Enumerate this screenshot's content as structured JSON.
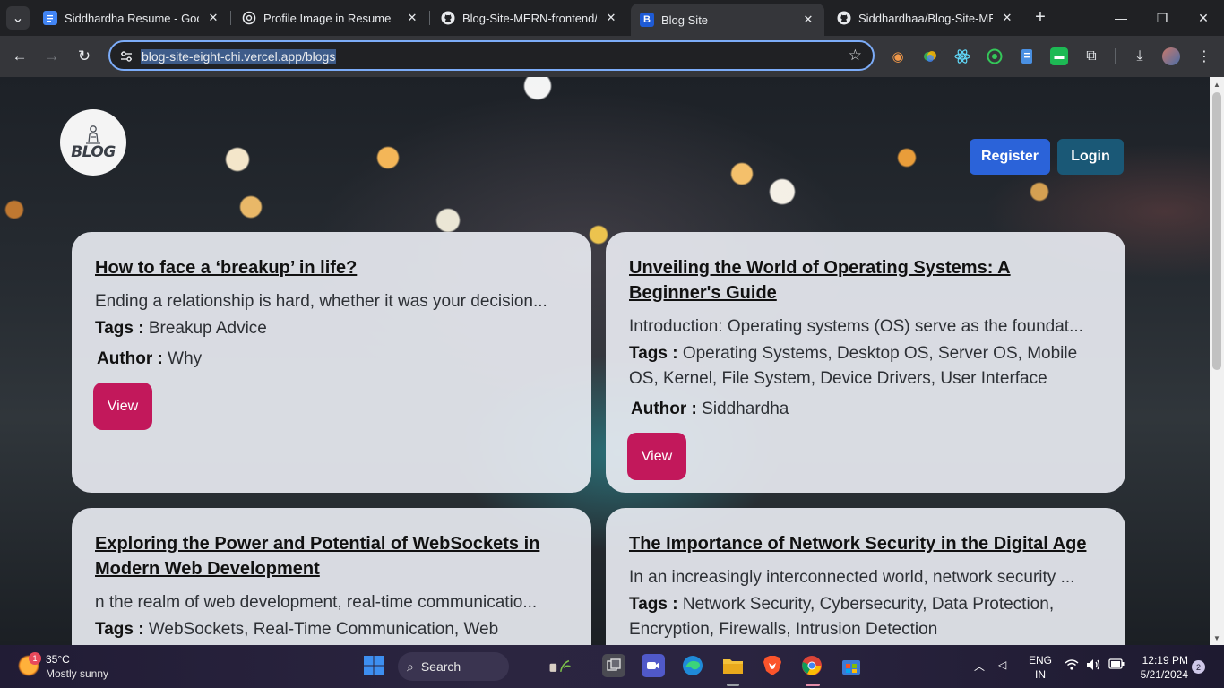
{
  "browser": {
    "tabs": [
      {
        "title": "Siddhardha Resume - Google Docs",
        "icon": "google-docs-icon",
        "color": "#4285f4"
      },
      {
        "title": "Profile Image in Resume",
        "icon": "chatgpt-icon",
        "color": "#ffffff"
      },
      {
        "title": "Blog-Site-MERN-frontend/R",
        "icon": "github-icon",
        "color": "#ffffff"
      },
      {
        "title": "Blog Site",
        "icon": "blog-favicon-icon",
        "color": "#1e5bd6"
      },
      {
        "title": "Siddhardhaa/Blog-Site-MERN",
        "icon": "github-icon",
        "color": "#ffffff"
      }
    ],
    "url": "blog-site-eight-chi.vercel.app/blogs",
    "new_tab": "+",
    "window_controls": {
      "minimize": "—",
      "maximize": "❐",
      "close": "✕"
    },
    "active_tab_index": 3
  },
  "site": {
    "logo_text": "BLOG",
    "register_label": "Register",
    "login_label": "Login",
    "register_color": "#2b63d9",
    "login_color": "#1a5876"
  },
  "labels": {
    "tags": "Tags :",
    "author": "Author :",
    "view": "View"
  },
  "blogs": [
    {
      "title": "How to face a ‘breakup’ in life?",
      "excerpt": "Ending a relationship is hard, whether it was your decision...",
      "tags": "Breakup Advice",
      "author": "Why"
    },
    {
      "title": "Unveiling the World of Operating Systems: A Beginner's Guide",
      "excerpt": "Introduction: Operating systems (OS) serve as the foundat...",
      "tags": "Operating Systems, Desktop OS, Server OS, Mobile OS, Kernel, File System, Device Drivers, User Interface",
      "author": "Siddhardha"
    },
    {
      "title": "Exploring the Power and Potential of WebSockets in Modern Web Development",
      "excerpt": "n the realm of web development, real-time communicatio...",
      "tags": "WebSockets, Real-Time Communication, Web",
      "author": ""
    },
    {
      "title": "The Importance of Network Security in the Digital Age",
      "excerpt": "In an increasingly interconnected world, network security ...",
      "tags": "Network Security, Cybersecurity, Data Protection, Encryption, Firewalls, Intrusion Detection",
      "author": ""
    }
  ],
  "taskbar": {
    "weather_temp": "35°C",
    "weather_condition": "Mostly sunny",
    "weather_badge": "1",
    "search_label": "Search",
    "language_line1": "ENG",
    "language_line2": "IN",
    "time": "12:19 PM",
    "date": "5/21/2024",
    "notification_count": "2"
  }
}
